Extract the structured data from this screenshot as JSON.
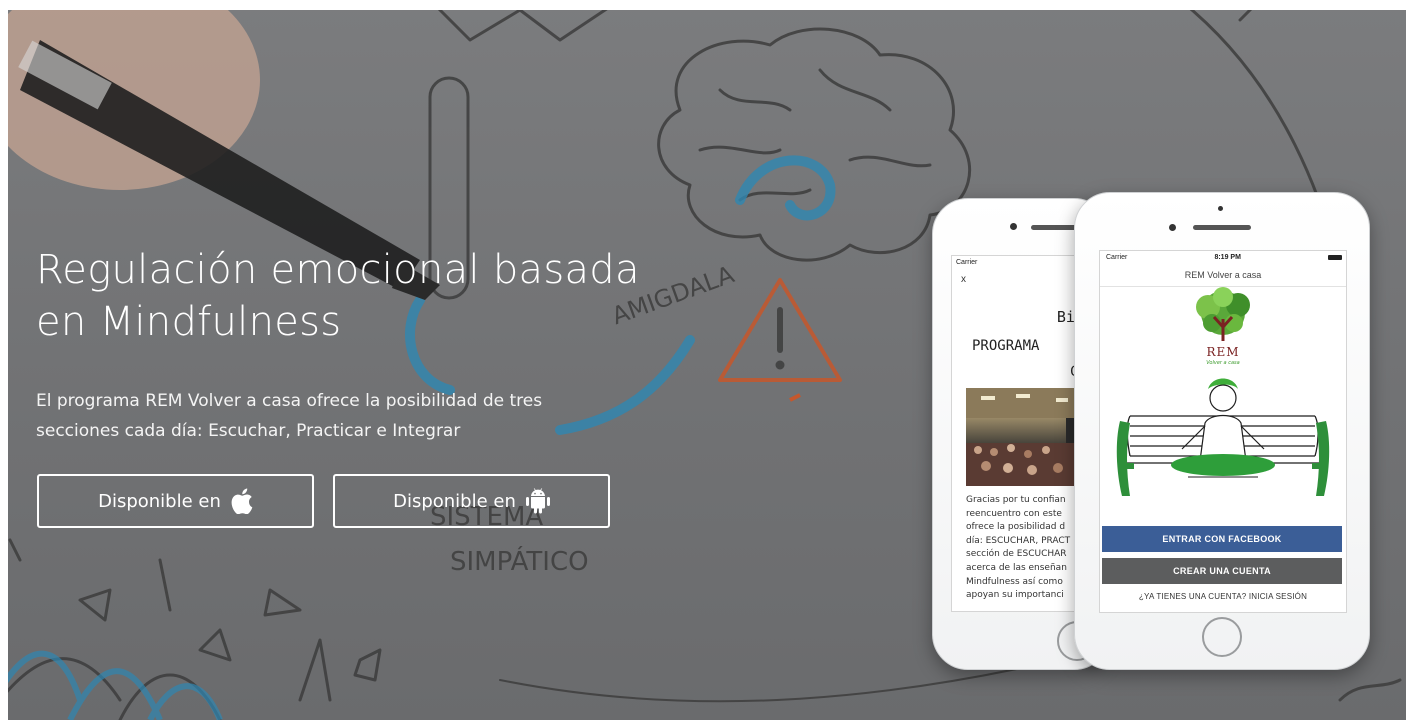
{
  "hero": {
    "headline_line1": "Regulación emocional basada",
    "headline_line2": "en Mindfulness",
    "subtitle_line1": "El programa REM Volver a casa ofrece la posibilidad de tres",
    "subtitle_line2": "secciones cada día: Escuchar, Practicar e Integrar"
  },
  "buttons": {
    "ios_label": "Disponible en",
    "ios_icon": "apple-icon",
    "android_label": "Disponible en",
    "android_icon": "android-icon"
  },
  "background": {
    "sketch_label_1": "AMIGDALA",
    "sketch_label_2": "SISTEMA",
    "sketch_label_3": "SIMPÁTICO",
    "text_color": "#ffffff",
    "overlay_color": "#6f7072"
  },
  "phone_back": {
    "carrier": "Carrier",
    "close_label": "x",
    "welcome": "Bienv",
    "program": "PROGRAMA",
    "letter_c": "C",
    "body_lines": [
      "Gracias por tu confian",
      "reencuentro con este",
      "ofrece la posibilidad d",
      "día: ESCUCHAR, PRACT",
      "sección de ESCUCHAR",
      "acerca de las enseñan",
      "Mindfulness así como",
      "apoyan su importanci"
    ]
  },
  "phone_front": {
    "carrier": "Carrier",
    "time": "8:19 PM",
    "app_title": "REM Volver a casa",
    "logo_text": "REM",
    "logo_sub": "Volver a casa",
    "facebook_button": "ENTRAR CON FACEBOOK",
    "create_account_button": "CREAR UNA CUENTA",
    "login_link": "¿YA TIENES UNA CUENTA? INICIA SESIÓN",
    "facebook_color": "#3b5e97",
    "create_color": "#5c5d5e"
  }
}
